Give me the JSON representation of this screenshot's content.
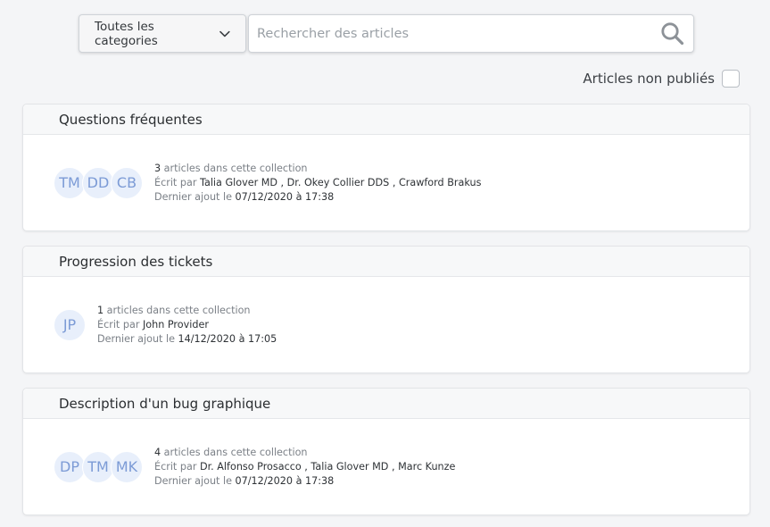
{
  "toolbar": {
    "category_label": "Toutes les categories",
    "search_placeholder": "Rechercher des articles"
  },
  "unpublished_label": "Articles non publiés",
  "collections": [
    {
      "title": "Questions fréquentes",
      "avatars": [
        "TM",
        "DD",
        "CB"
      ],
      "count": "3",
      "count_suffix": " articles dans cette collection",
      "written_by": "Écrit par ",
      "authors": [
        {
          "name": "Talia Glover MD",
          "sep": " , "
        },
        {
          "name": "Dr. Okey Collier DDS",
          "sep": " , "
        },
        {
          "name": "Crawford Brakus",
          "sep": ""
        }
      ],
      "last_added_label": "Dernier ajout le ",
      "last_added": "07/12/2020 à 17:38"
    },
    {
      "title": "Progression des tickets",
      "avatars": [
        "JP"
      ],
      "count": "1",
      "count_suffix": " articles dans cette collection",
      "written_by": "Écrit par ",
      "authors": [
        {
          "name": "John Provider",
          "sep": ""
        }
      ],
      "last_added_label": "Dernier ajout le ",
      "last_added": "14/12/2020 à 17:05"
    },
    {
      "title": "Description d'un bug graphique",
      "avatars": [
        "DP",
        "TM",
        "MK"
      ],
      "count": "4",
      "count_suffix": " articles dans cette collection",
      "written_by": "Écrit par ",
      "authors": [
        {
          "name": "Dr. Alfonso Prosacco",
          "sep": " , "
        },
        {
          "name": "Talia Glover MD",
          "sep": " , "
        },
        {
          "name": "Marc Kunze",
          "sep": ""
        }
      ],
      "last_added_label": "Dernier ajout le ",
      "last_added": "07/12/2020 à 17:38"
    }
  ]
}
